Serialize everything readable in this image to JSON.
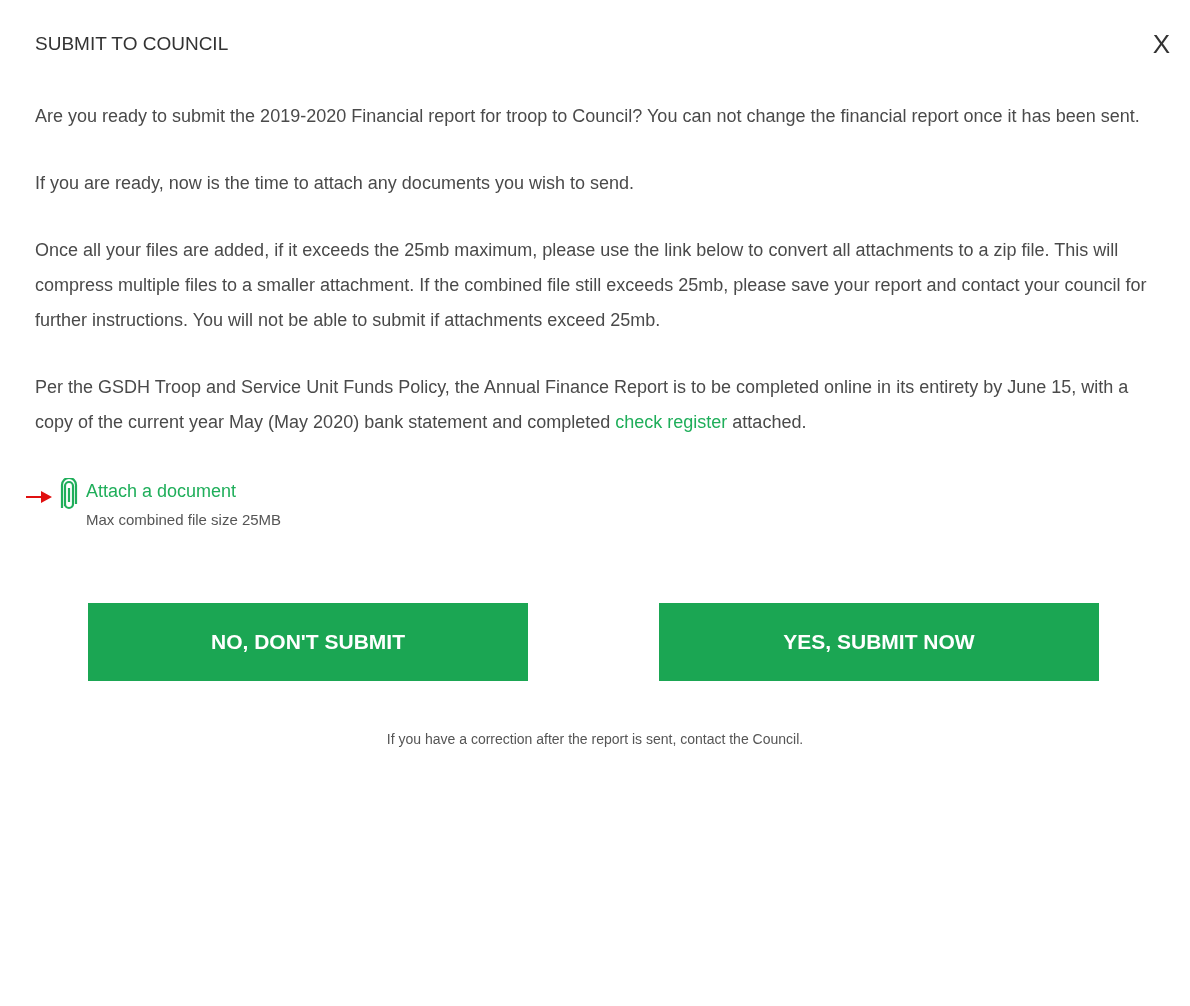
{
  "dialog": {
    "title": "SUBMIT TO COUNCIL",
    "close": "X"
  },
  "paragraphs": [
    {
      "text": "Are you ready to submit the 2019-2020 Financial report for troop to Council? You can not change the financial report once it has been sent."
    },
    {
      "text": "If you are ready, now is the time to attach any documents you wish to send."
    },
    {
      "text": "Once all your files are added, if it exceeds the 25mb maximum, please use the link below to convert all attachments to a zip file. This will compress multiple files to a smaller attachment. If the combined file still exceeds 25mb, please save your report and contact your council for further instructions. You will not be able to submit if attachments exceed 25mb."
    },
    {
      "text": "Per the GSDH Troop and Service Unit Funds Policy, the Annual Finance Report is to be completed online in its entirety by June 15, with a copy of the current year May (May 2020) bank statement and completed ",
      "link": "check register",
      "text_after": " attached."
    }
  ],
  "attach": {
    "label": "Attach a document",
    "note": "Max combined file size 25MB",
    "pointer_arrow": true
  },
  "buttons": [
    {
      "label": "NO, DON'T SUBMIT"
    },
    {
      "label": "YES, SUBMIT NOW"
    }
  ],
  "footer": "If you have a correction after the report is sent, contact the Council."
}
